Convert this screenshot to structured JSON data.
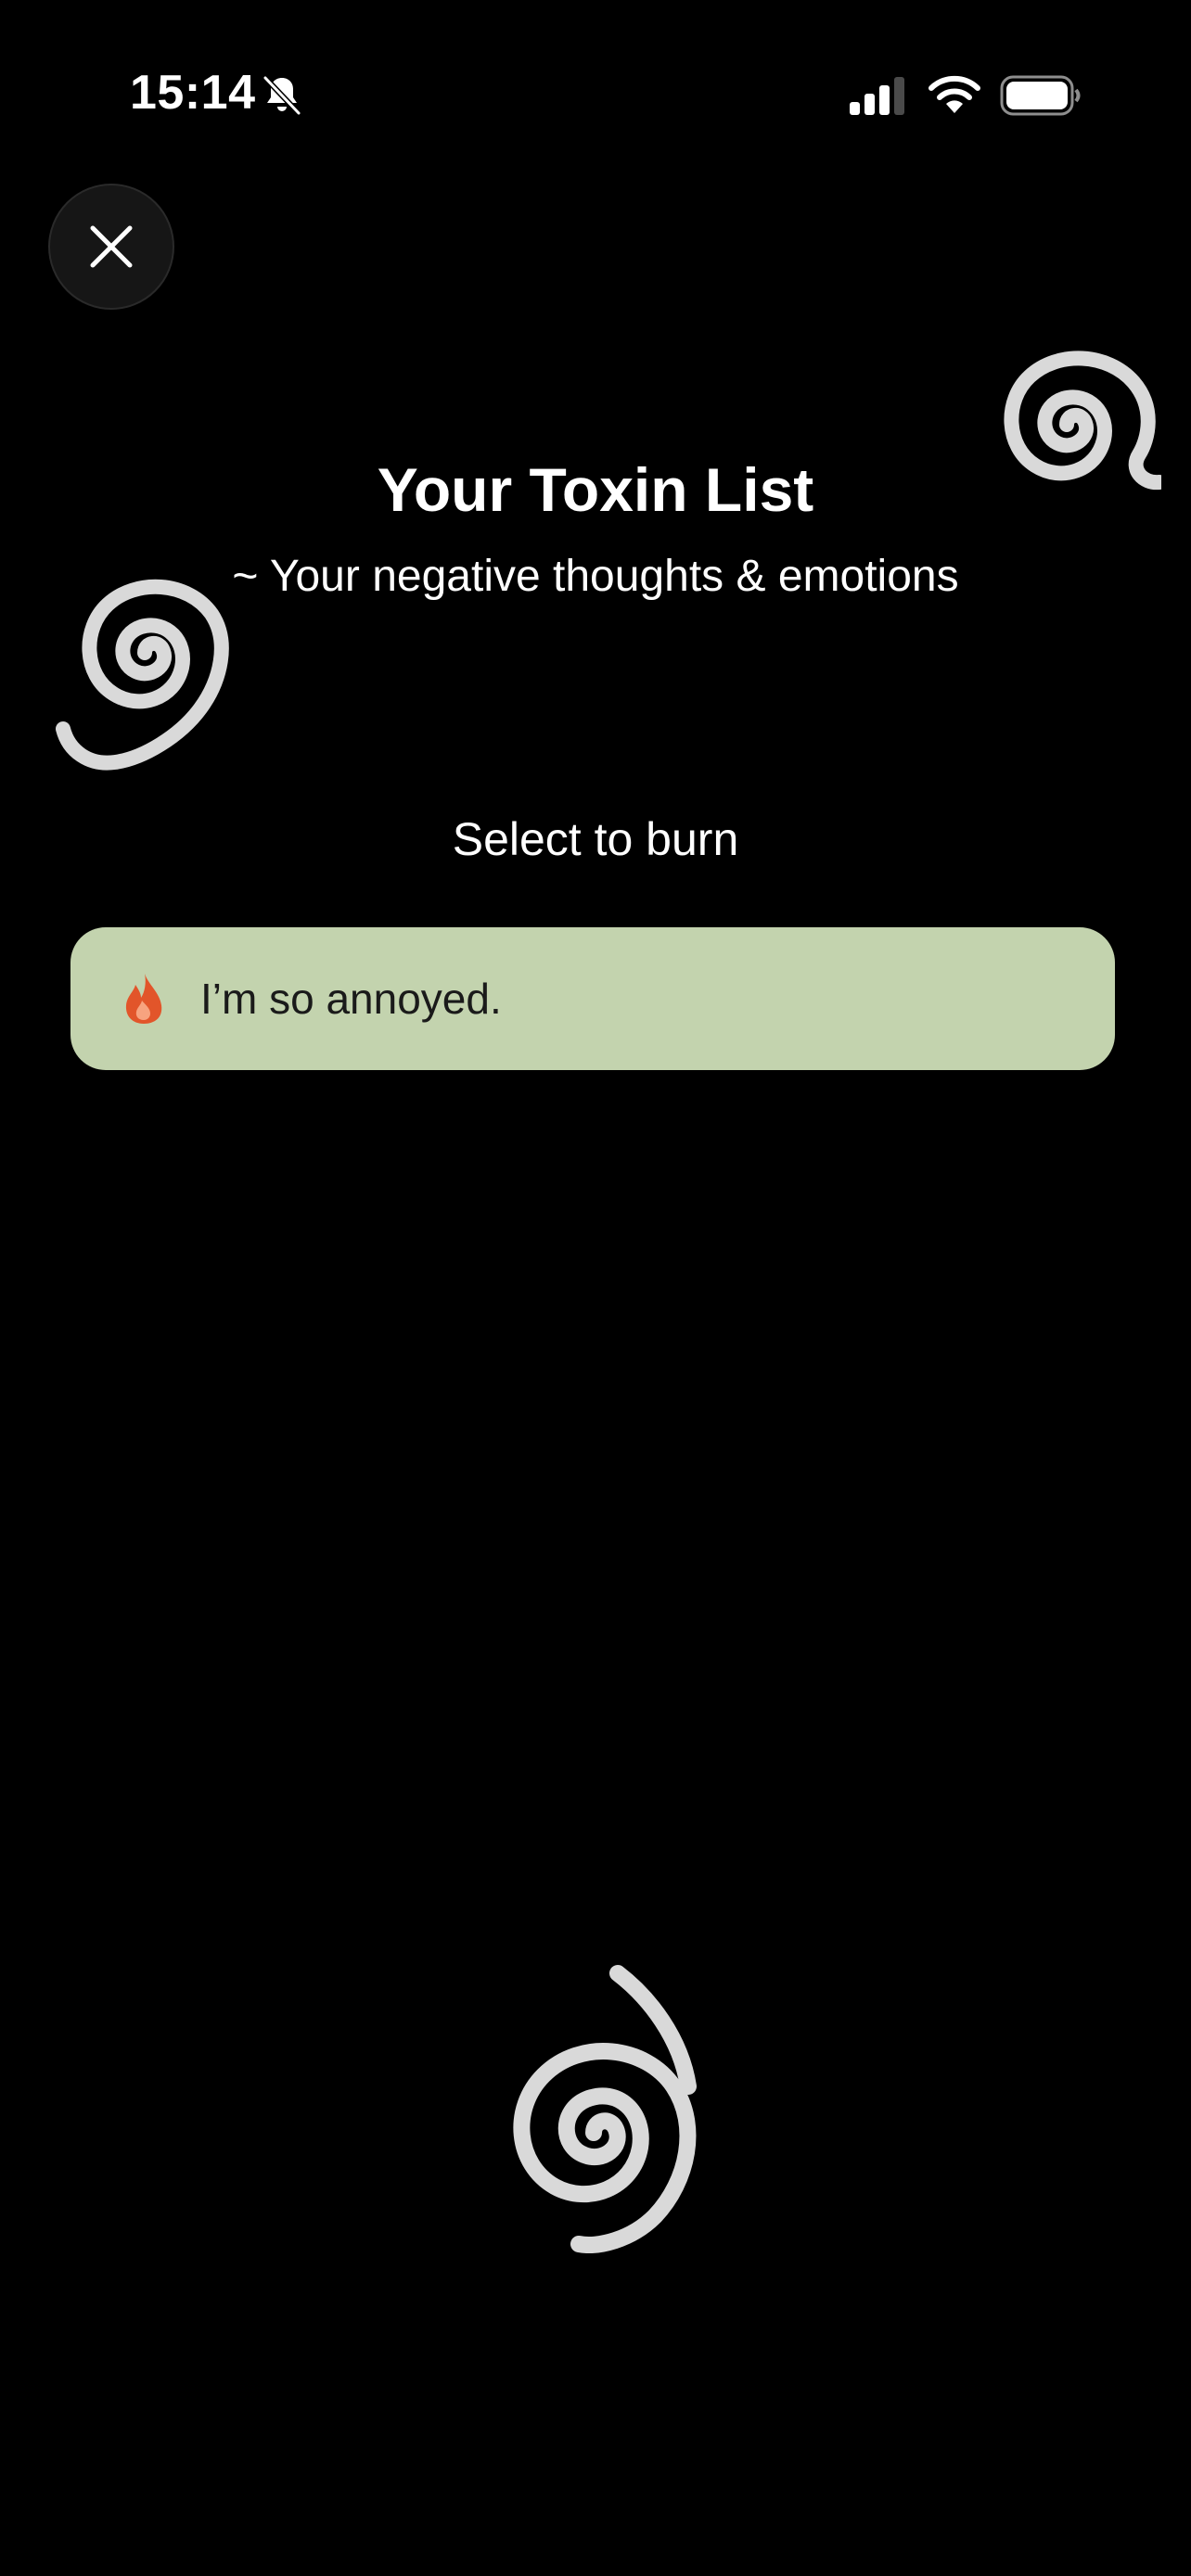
{
  "status_bar": {
    "time": "15:14",
    "icons": [
      "bell-slash-icon",
      "cellular-signal-icon",
      "wifi-icon",
      "battery-icon"
    ]
  },
  "header": {
    "close_icon": "close-icon",
    "title": "Your Toxin List",
    "subtitle": "~ Your negative thoughts & emotions"
  },
  "main": {
    "instruction": "Select to burn",
    "items": [
      {
        "icon": "flame-icon",
        "text": "I’m so annoyed."
      }
    ]
  },
  "colors": {
    "background": "#000000",
    "item_background": "#c3d3ae",
    "flame": "#e2552a",
    "swirl": "#d9d9d9",
    "text": "#ffffff"
  }
}
